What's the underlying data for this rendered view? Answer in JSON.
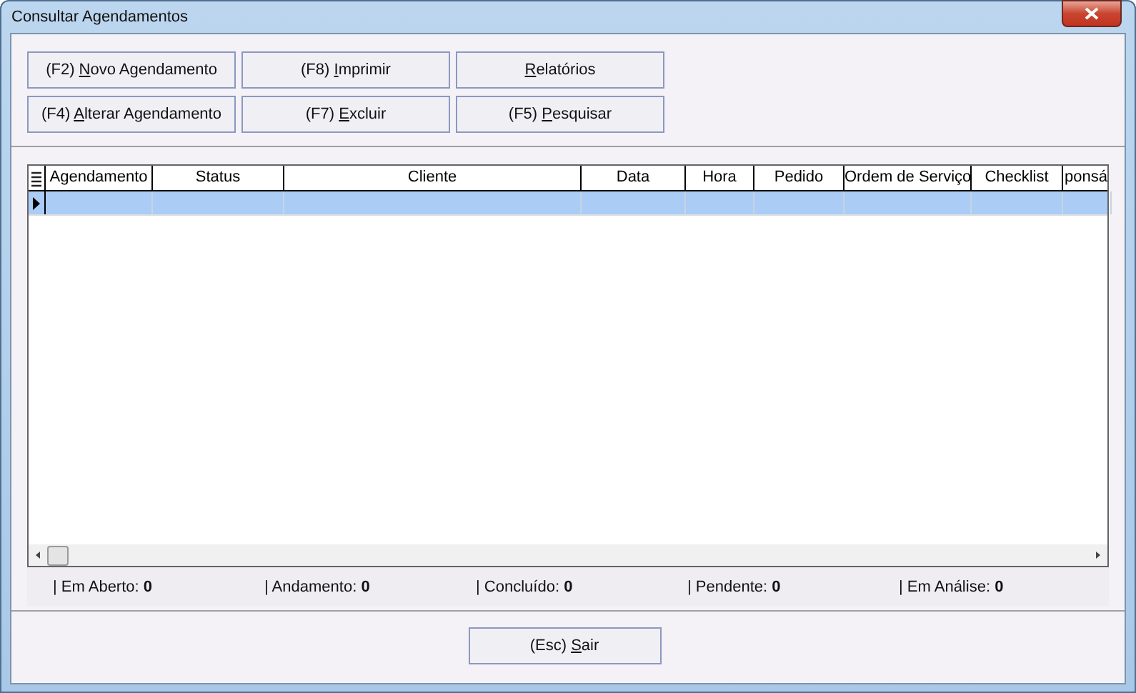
{
  "window": {
    "title": "Consultar Agendamentos"
  },
  "toolbar_buttons": [
    {
      "before": "(F2) ",
      "key": "N",
      "after": "ovo Agendamento"
    },
    {
      "before": "(F8) ",
      "key": "I",
      "after": "mprimir"
    },
    {
      "key": "R",
      "after": "elatórios"
    },
    {
      "before": "(F4) ",
      "key": "A",
      "after": "lterar Agendamento"
    },
    {
      "before": "(F7) ",
      "key": "E",
      "after": "xcluir"
    },
    {
      "before": "(F5) ",
      "key": "P",
      "after": "esquisar"
    }
  ],
  "table": {
    "columns": [
      "Agendamento",
      "Status",
      "Cliente",
      "Data",
      "Hora",
      "Pedido",
      "Ordem de Serviço",
      "Checklist",
      "ponsá"
    ],
    "rows": [
      {
        "selected": true
      }
    ]
  },
  "status_bar": [
    "| Em Aberto: **0**",
    "| Andamento: **0**",
    "| Concluído: **0**",
    "| Pendente: **0**",
    "| Em Análise: **0**"
  ],
  "footer_button": {
    "before": "(Esc) ",
    "key": "S",
    "after": "air"
  }
}
